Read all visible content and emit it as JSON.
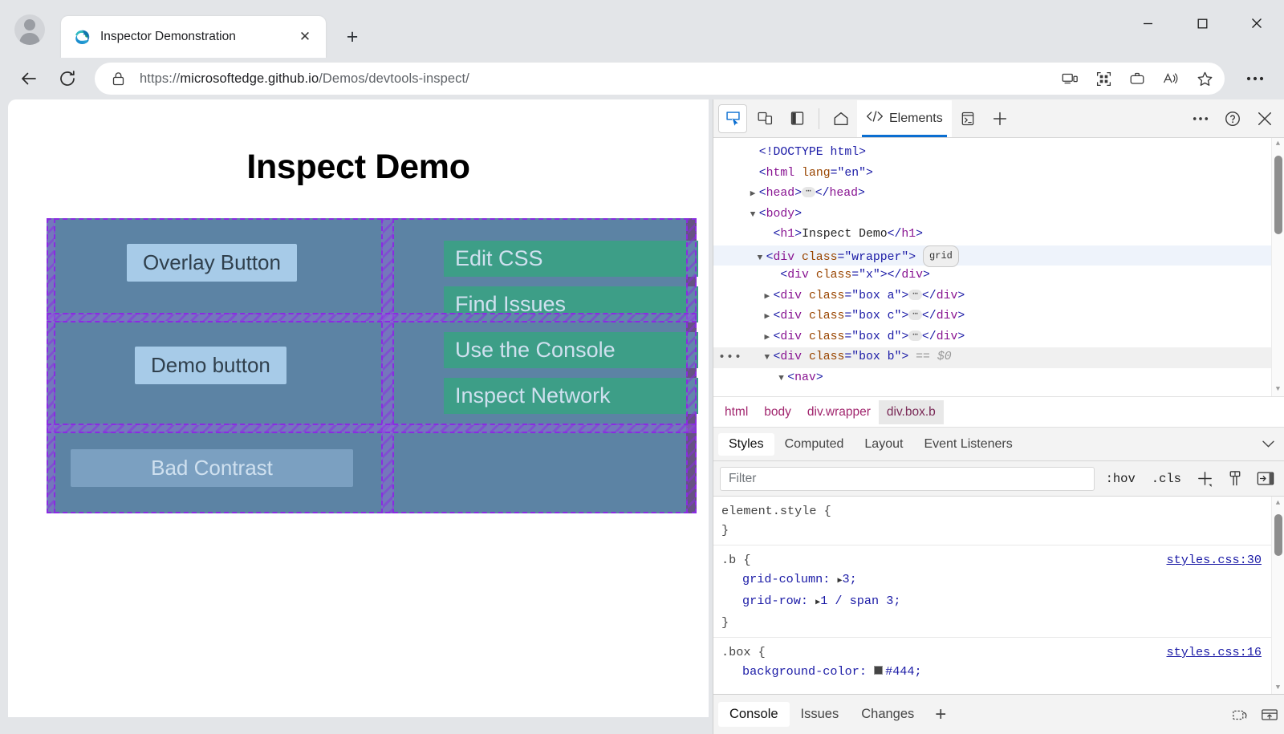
{
  "browser": {
    "tab": {
      "title": "Inspector Demonstration",
      "favicon": "edge-logo-icon",
      "close_label": "✕"
    },
    "new_tab_label": "+",
    "url_protocol": "https://",
    "url_domain": "microsoftedge.github.io",
    "url_path": "/Demos/devtools-inspect/",
    "toolbar_icons": [
      "back-icon",
      "reload-icon",
      "lock-icon",
      "cast-icon",
      "collections-grid-icon",
      "browser-essentials-icon",
      "read-aloud-icon",
      "favorite-star-icon",
      "settings-more-icon"
    ],
    "window_controls": [
      "minimize",
      "maximize",
      "close"
    ]
  },
  "page": {
    "heading": "Inspect Demo",
    "buttons": {
      "overlay": "Overlay Button",
      "demo": "Demo button",
      "bad_contrast": "Bad Contrast"
    },
    "nav_links": [
      "Edit CSS",
      "Find Issues",
      "Use the Console",
      "Inspect Network"
    ],
    "colors": {
      "box_bg": "#5c83a4",
      "wrapper_bg": "#444444",
      "link_bg": "#3d9e87",
      "btn_bg": "#a7cbe8",
      "grid_overlay": "#8a2be2"
    }
  },
  "devtools": {
    "toolbar": {
      "inspect_icon": "inspect-element-icon",
      "device_icon": "device-emulation-icon",
      "sidebar_icon": "dock-sidebar-icon",
      "home_icon": "welcome-home-icon",
      "more_icon": "more-tools-icon",
      "help_icon": "help-icon",
      "close_icon": "close-devtools-icon",
      "add_tab_label": "+",
      "console_drawer_icon": "console-drawer-icon"
    },
    "tabs": [
      {
        "label": "Elements",
        "icon": "elements-code-icon",
        "active": true
      }
    ],
    "dom_tree": [
      {
        "indent": 1,
        "twisty": "",
        "gutter": "",
        "selected": false,
        "highlight": false,
        "parts": [
          {
            "t": "b",
            "v": "<!DOCTYPE html>"
          }
        ]
      },
      {
        "indent": 1,
        "twisty": "",
        "gutter": "",
        "selected": false,
        "highlight": false,
        "parts": [
          {
            "t": "b",
            "v": "<"
          },
          {
            "t": "p",
            "v": "html"
          },
          {
            "t": "attr",
            "v": " lang"
          },
          {
            "t": "b",
            "v": "="
          },
          {
            "t": "val",
            "v": "\"en\""
          },
          {
            "t": "b",
            "v": ">"
          }
        ]
      },
      {
        "indent": 1,
        "twisty": "▶",
        "gutter": "",
        "selected": false,
        "highlight": false,
        "parts": [
          {
            "t": "b",
            "v": "<"
          },
          {
            "t": "p",
            "v": "head"
          },
          {
            "t": "b",
            "v": ">"
          },
          {
            "t": "dots",
            "v": "⋯"
          },
          {
            "t": "b",
            "v": "</"
          },
          {
            "t": "p",
            "v": "head"
          },
          {
            "t": "b",
            "v": ">"
          }
        ]
      },
      {
        "indent": 1,
        "twisty": "▼",
        "gutter": "",
        "selected": false,
        "highlight": false,
        "parts": [
          {
            "t": "b",
            "v": "<"
          },
          {
            "t": "p",
            "v": "body"
          },
          {
            "t": "b",
            "v": ">"
          }
        ]
      },
      {
        "indent": 2,
        "twisty": "",
        "gutter": "",
        "selected": false,
        "highlight": false,
        "parts": [
          {
            "t": "b",
            "v": "<"
          },
          {
            "t": "p",
            "v": "h1"
          },
          {
            "t": "b",
            "v": ">"
          },
          {
            "t": "txt",
            "v": "Inspect Demo"
          },
          {
            "t": "b",
            "v": "</"
          },
          {
            "t": "p",
            "v": "h1"
          },
          {
            "t": "b",
            "v": ">"
          }
        ]
      },
      {
        "indent": 1.6,
        "twisty": "▼",
        "gutter": "",
        "selected": true,
        "highlight": false,
        "parts": [
          {
            "t": "b",
            "v": "<"
          },
          {
            "t": "p",
            "v": "div"
          },
          {
            "t": "attr",
            "v": " class"
          },
          {
            "t": "b",
            "v": "="
          },
          {
            "t": "val",
            "v": "\"wrapper\""
          },
          {
            "t": "b",
            "v": ">"
          },
          {
            "t": "badge",
            "v": "grid"
          }
        ]
      },
      {
        "indent": 2.6,
        "twisty": "",
        "gutter": "",
        "selected": false,
        "highlight": false,
        "parts": [
          {
            "t": "b",
            "v": "<"
          },
          {
            "t": "p",
            "v": "div"
          },
          {
            "t": "attr",
            "v": " class"
          },
          {
            "t": "b",
            "v": "="
          },
          {
            "t": "val",
            "v": "\"x\""
          },
          {
            "t": "b",
            "v": "></"
          },
          {
            "t": "p",
            "v": "div"
          },
          {
            "t": "b",
            "v": ">"
          }
        ]
      },
      {
        "indent": 2.2,
        "twisty": "▶",
        "gutter": "",
        "selected": false,
        "highlight": false,
        "parts": [
          {
            "t": "b",
            "v": "<"
          },
          {
            "t": "p",
            "v": "div"
          },
          {
            "t": "attr",
            "v": " class"
          },
          {
            "t": "b",
            "v": "="
          },
          {
            "t": "val",
            "v": "\"box a\""
          },
          {
            "t": "b",
            "v": ">"
          },
          {
            "t": "dots",
            "v": "⋯"
          },
          {
            "t": "b",
            "v": "</"
          },
          {
            "t": "p",
            "v": "div"
          },
          {
            "t": "b",
            "v": ">"
          }
        ]
      },
      {
        "indent": 2.2,
        "twisty": "▶",
        "gutter": "",
        "selected": false,
        "highlight": false,
        "parts": [
          {
            "t": "b",
            "v": "<"
          },
          {
            "t": "p",
            "v": "div"
          },
          {
            "t": "attr",
            "v": " class"
          },
          {
            "t": "b",
            "v": "="
          },
          {
            "t": "val",
            "v": "\"box c\""
          },
          {
            "t": "b",
            "v": ">"
          },
          {
            "t": "dots",
            "v": "⋯"
          },
          {
            "t": "b",
            "v": "</"
          },
          {
            "t": "p",
            "v": "div"
          },
          {
            "t": "b",
            "v": ">"
          }
        ]
      },
      {
        "indent": 2.2,
        "twisty": "▶",
        "gutter": "",
        "selected": false,
        "highlight": false,
        "parts": [
          {
            "t": "b",
            "v": "<"
          },
          {
            "t": "p",
            "v": "div"
          },
          {
            "t": "attr",
            "v": " class"
          },
          {
            "t": "b",
            "v": "="
          },
          {
            "t": "val",
            "v": "\"box d\""
          },
          {
            "t": "b",
            "v": ">"
          },
          {
            "t": "dots",
            "v": "⋯"
          },
          {
            "t": "b",
            "v": "</"
          },
          {
            "t": "p",
            "v": "div"
          },
          {
            "t": "b",
            "v": ">"
          }
        ]
      },
      {
        "indent": 2.2,
        "twisty": "▼",
        "gutter": "•••",
        "selected": false,
        "highlight": true,
        "parts": [
          {
            "t": "b",
            "v": "<"
          },
          {
            "t": "p",
            "v": "div"
          },
          {
            "t": "attr",
            "v": " class"
          },
          {
            "t": "b",
            "v": "="
          },
          {
            "t": "val",
            "v": "\"box b\""
          },
          {
            "t": "b",
            "v": ">"
          },
          {
            "t": "gray",
            "v": " == $0"
          }
        ]
      },
      {
        "indent": 3.0,
        "twisty": "▼",
        "gutter": "",
        "selected": false,
        "highlight": false,
        "parts": [
          {
            "t": "b",
            "v": "<"
          },
          {
            "t": "p",
            "v": "nav"
          },
          {
            "t": "b",
            "v": ">"
          }
        ]
      }
    ],
    "breadcrumb": [
      {
        "label": "html",
        "active": false
      },
      {
        "label": "body",
        "active": false
      },
      {
        "label": "div.wrapper",
        "active": false
      },
      {
        "label": "div.box.b",
        "active": true
      }
    ],
    "styles_tabs": [
      {
        "label": "Styles",
        "active": true
      },
      {
        "label": "Computed",
        "active": false
      },
      {
        "label": "Layout",
        "active": false
      },
      {
        "label": "Event Listeners",
        "active": false
      }
    ],
    "filter": {
      "placeholder": "Filter",
      "value": ""
    },
    "filter_buttons": [
      ":hov",
      ".cls"
    ],
    "filter_icons": [
      "new-style-rule-icon",
      "toggle-element-state-icon",
      "computed-sidebar-icon"
    ],
    "css_rules": [
      {
        "selector": "element.style {",
        "source": "",
        "declarations": [],
        "close": "}"
      },
      {
        "selector": ".b {",
        "source": "styles.css:30",
        "declarations": [
          {
            "prop": "grid-column:",
            "expand": "▶",
            "value": "3;"
          },
          {
            "prop": "grid-row:",
            "expand": "▶",
            "value": "1 / span 3;"
          }
        ],
        "close": "}"
      },
      {
        "selector": ".box {",
        "source": "styles.css:16",
        "declarations": [
          {
            "prop": "background-color:",
            "expand": "",
            "swatch": "#444",
            "value": "#444;"
          }
        ],
        "close": ""
      }
    ],
    "drawer_tabs": [
      {
        "label": "Console",
        "active": true
      },
      {
        "label": "Issues",
        "active": false
      },
      {
        "label": "Changes",
        "active": false
      }
    ],
    "drawer_add_label": "+",
    "drawer_icons": [
      "restore-drawer-icon",
      "move-to-top-icon"
    ]
  }
}
